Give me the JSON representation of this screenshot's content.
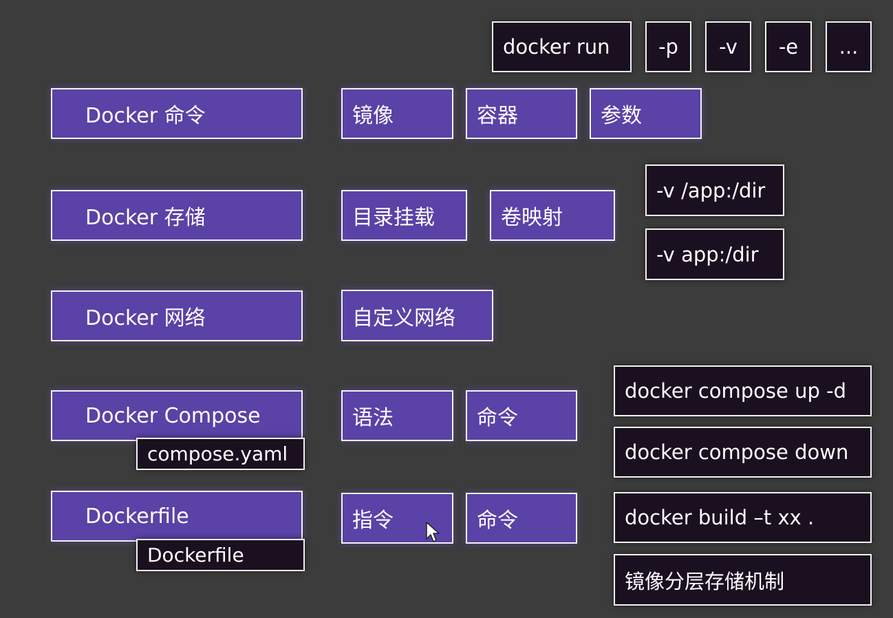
{
  "top_row": {
    "run": "docker run",
    "flags": [
      "-p",
      "-v",
      "-e",
      "..."
    ]
  },
  "commands": {
    "label": "Docker 命令",
    "items": [
      "镜像",
      "容器",
      "参数"
    ]
  },
  "storage": {
    "label": "Docker 存储",
    "items": [
      "目录挂载",
      "卷映射"
    ],
    "examples": [
      "-v /app:/dir",
      "-v app:/dir"
    ]
  },
  "network": {
    "label": "Docker 网络",
    "items": [
      "自定义网络"
    ]
  },
  "compose": {
    "label": "Docker Compose",
    "file": "compose.yaml",
    "items": [
      "语法",
      "命令"
    ],
    "commands": [
      "docker compose up -d",
      "docker compose down"
    ]
  },
  "dockerfile": {
    "label": "Dockerfile",
    "file": "Dockerfile",
    "items": [
      "指令",
      "命令"
    ],
    "commands": [
      "docker build –t xx .",
      "镜像分层存储机制"
    ]
  },
  "colors": {
    "background": "#3c3c3c",
    "purple_box": "#5a42a6",
    "dark_box": "#1b1020",
    "border": "#f2f2f2"
  }
}
